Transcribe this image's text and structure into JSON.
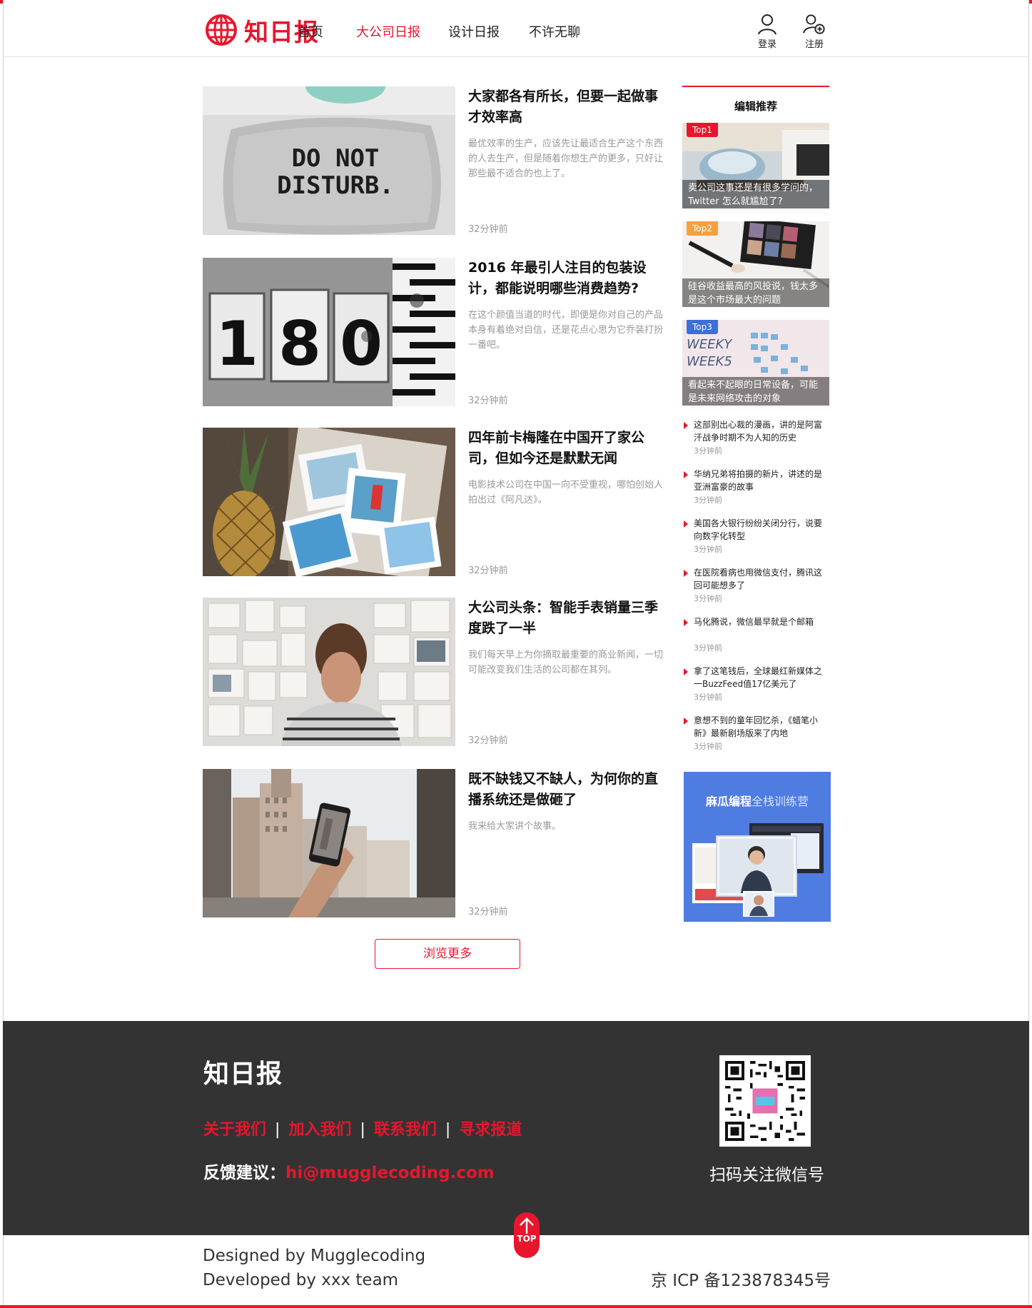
{
  "site": {
    "logo_text": "知日报",
    "brand_color": "#e8162d",
    "nav": [
      {
        "label": "首页",
        "active": false
      },
      {
        "label": "大公司日报",
        "active": true
      },
      {
        "label": "设计日报",
        "active": false
      },
      {
        "label": "不许无聊",
        "active": false
      }
    ],
    "login_label": "登录",
    "register_label": "注册"
  },
  "articles": [
    {
      "title": "大家都各有所长，但要一起做事才效率高",
      "summary": "最优效率的生产，应该先让最适合生产这个东西的人去生产，但是随着你想生产的更多，只好让那些最不适合的也上了。",
      "time": "32分钟前",
      "image": "pillow-do-not-disturb",
      "image_text": [
        "DO NOT",
        "DISTURB."
      ]
    },
    {
      "title": "2016 年最引人注目的包装设计，都能说明哪些消费趋势?",
      "summary": "在这个颜值当道的时代，即便是你对自己的产品本身有着绝对自信，还是花点心思为它乔装打扮一番吧。",
      "time": "32分钟前",
      "image": "number-tiles-180",
      "image_text": [
        "1",
        "8",
        "0"
      ]
    },
    {
      "title": "四年前卡梅隆在中国开了家公司，但如今还是默默无闻",
      "summary": "电影技术公司在中国一向不受重视，哪怕创始人拍出过《阿凡达》。",
      "time": "32分钟前",
      "image": "pineapple-and-photos"
    },
    {
      "title": "大公司头条：智能手表销量三季度跌了一半",
      "summary": "我们每天早上为你摘取最重要的商业新闻，一切可能改变我们生活的公司都在其列。",
      "time": "32分钟前",
      "image": "man-at-wall"
    },
    {
      "title": "既不缺钱又不缺人，为何你的直播系统还是做砸了",
      "summary": "我来给大家讲个故事。",
      "time": "32分钟前",
      "image": "phone-photo-city"
    }
  ],
  "more_button": "浏览更多",
  "sidebar": {
    "heading": "编辑推荐",
    "top": [
      {
        "tag": "Top1",
        "tag_color": "#e8162d",
        "caption": "卖公司这事还是有很多学问的，Twitter 怎么就尴尬了?",
        "image": "office-chair"
      },
      {
        "tag": "Top2",
        "tag_color": "#f5a040",
        "caption": "硅谷收益最高的风投说，钱太多是这个市场最大的问题",
        "image": "makeup-palette"
      },
      {
        "tag": "Top3",
        "tag_color": "#3d6fd8",
        "caption": "看起来不起眼的日常设备，可能是未来网络攻击的对象",
        "image": "whiteboard-sticky-notes",
        "image_text": [
          "WEEKY",
          "WEEK5"
        ]
      }
    ],
    "list": [
      {
        "title": "这部别出心裁的漫画，讲的是阿富汗战争时期不为人知的历史",
        "time": "3分钟前"
      },
      {
        "title": "华纳兄弟将拍摄的新片，讲述的是亚洲富豪的故事",
        "time": "3分钟前"
      },
      {
        "title": "美国各大银行纷纷关闭分行，说要向数字化转型",
        "time": "3分钟前"
      },
      {
        "title": "在医院看病也用微信支付，腾讯这回可能想多了",
        "time": "3分钟前"
      },
      {
        "title": "马化腾说，微信最早就是个邮箱",
        "time": "3分钟前"
      },
      {
        "title": "拿了这笔钱后，全球最红新媒体之一BuzzFeed值17亿美元了",
        "time": "3分钟前"
      },
      {
        "title": "意想不到的童年回忆杀，《蜡笔小新》最新剧场版来了内地",
        "time": "3分钟前"
      }
    ],
    "ad": {
      "title_strong": "麻瓜编程",
      "title_rest": "全栈训练营",
      "bg_color": "#4f7ce0"
    }
  },
  "footer": {
    "logo_text": "知日报",
    "links": [
      "关于我们",
      "加入我们",
      "联系我们",
      "寻求报道"
    ],
    "separator": "|",
    "feedback_label": "反馈建议：",
    "feedback_email": "hi@mugglecoding.com",
    "qr_caption": "扫码关注微信号",
    "bg_color": "#333333"
  },
  "top_button": "TOP",
  "credits": [
    "Designed by Mugglecoding",
    "Developed by xxx team"
  ],
  "icp": "京 ICP 备123878345号"
}
